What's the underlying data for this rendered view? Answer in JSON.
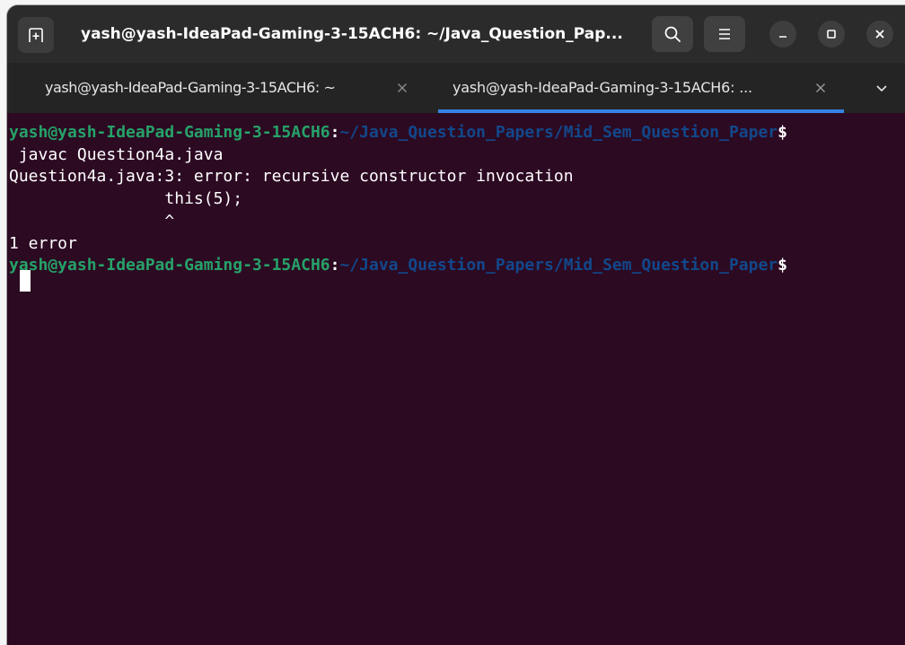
{
  "window": {
    "title": "yash@yash-IdeaPad-Gaming-3-15ACH6: ~/Java_Question_Pap...",
    "buttons": {
      "new_tab_icon": "new-tab-icon",
      "search_icon": "search-icon",
      "menu_icon": "hamburger-menu-icon",
      "minimize_icon": "minimize-icon",
      "maximize_icon": "maximize-icon",
      "close_icon": "close-icon"
    }
  },
  "tabs": [
    {
      "label": "yash@yash-IdeaPad-Gaming-3-15ACH6: ~",
      "active": false
    },
    {
      "label": "yash@yash-IdeaPad-Gaming-3-15ACH6: ...",
      "active": true
    }
  ],
  "terminal": {
    "prompt": {
      "user_host": "yash@yash-IdeaPad-Gaming-3-15ACH6",
      "separator": ":",
      "path": "~/Java_Question_Papers/Mid_Sem_Question_Paper",
      "symbol": "$"
    },
    "lines": [
      " javac Question4a.java",
      "Question4a.java:3: error: recursive constructor invocation",
      "                this(5);",
      "                ^",
      "1 error"
    ]
  },
  "colors": {
    "terminal_bg": "#2c0a22",
    "prompt_user": "#26a269",
    "prompt_path": "#12488b",
    "tab_active_underline": "#3584e4",
    "titlebar_bg": "#2b2b2b",
    "tabbar_bg": "#242424"
  }
}
